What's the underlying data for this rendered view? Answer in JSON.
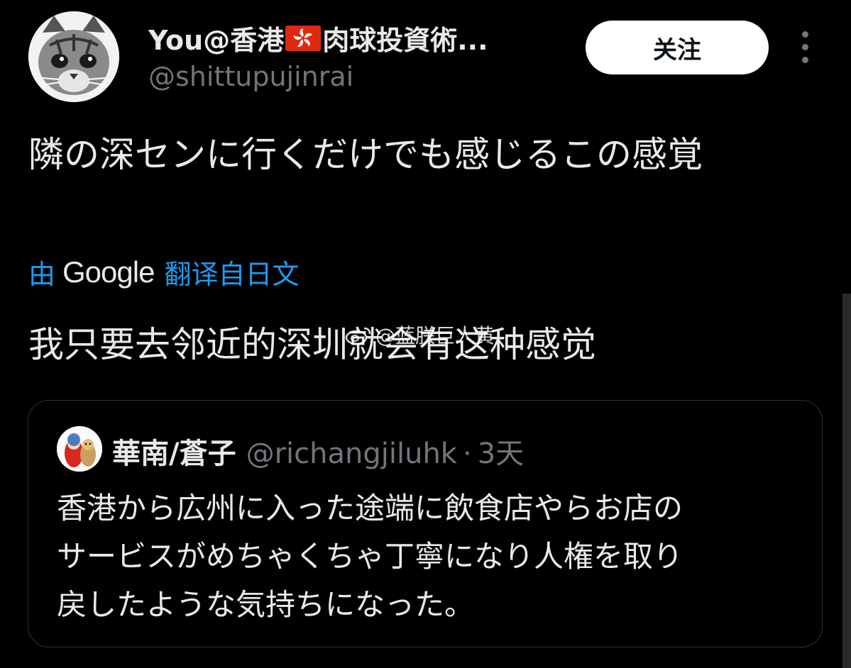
{
  "author": {
    "display_name_prefix": "You@香港",
    "flag": "hong-kong-flag-icon",
    "display_name_suffix": "肉球投資術...",
    "handle": "@shittupujinrai",
    "avatar": "cat-avatar"
  },
  "follow_button": {
    "label": "关注"
  },
  "more_icon": "more-vertical-icon",
  "tweet": {
    "text": "隣の深センに行くだけでも感じるこの感覚"
  },
  "translation": {
    "prefix": "由",
    "provider": "Google",
    "suffix": "翻译自日文",
    "text": "我只要去邻近的深圳就会有这种感觉"
  },
  "watermark": {
    "icon": "weibo-icon",
    "text": "@蓝朕巨人黄"
  },
  "quoted_tweet": {
    "display_name": "華南/蒼子",
    "handle": "@richangjiluhk",
    "separator": "·",
    "time": "3天",
    "lines": [
      "香港から広州に入った途端に飲食店やらお店の",
      "サービスがめちゃくちゃ丁寧になり人権を取り",
      "戻したような気持ちになった。"
    ]
  },
  "colors": {
    "background": "#000000",
    "text": "#e7e9ea",
    "secondary": "#71767b",
    "accent": "#1d9bf0",
    "border": "#2f3336"
  }
}
